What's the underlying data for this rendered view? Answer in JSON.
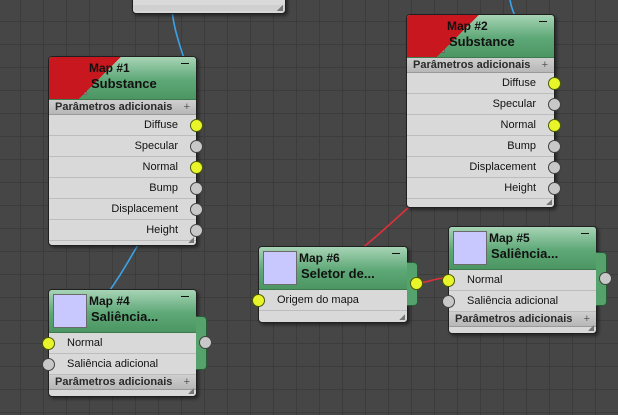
{
  "colors": {
    "canvas": "#464646",
    "node_body": "#d9d9d9",
    "node_header": "#5ea877",
    "wire_blue": "#3aa3e8",
    "wire_red": "#e0303a",
    "socket_active": "#e7f52a"
  },
  "nodes": {
    "map1": {
      "title": "Map #1",
      "subtitle": "Substance",
      "section_label": "Parâmetros adicionais",
      "slots": [
        "Diffuse",
        "Specular",
        "Normal",
        "Bump",
        "Displacement",
        "Height"
      ]
    },
    "map2": {
      "title": "Map #2",
      "subtitle": "Substance",
      "section_label": "Parâmetros adicionais",
      "slots": [
        "Diffuse",
        "Specular",
        "Normal",
        "Bump",
        "Displacement",
        "Height"
      ]
    },
    "map4": {
      "title": "Map #4",
      "subtitle": "Saliência...",
      "slots": [
        "Normal",
        "Saliência adicional"
      ],
      "section_label": "Parâmetros adicionais"
    },
    "map5": {
      "title": "Map #5",
      "subtitle": "Saliência...",
      "slots": [
        "Normal",
        "Saliência adicional"
      ],
      "section_label": "Parâmetros adicionais"
    },
    "map6": {
      "title": "Map #6",
      "subtitle": "Seletor de...",
      "slots": [
        "Origem do mapa"
      ]
    }
  },
  "icons": {
    "substance_thumb": "material-swatch-icon",
    "normal_thumb": "normal-map-swatch-icon",
    "minimize": "minimize-icon",
    "expand": "plus-icon"
  }
}
